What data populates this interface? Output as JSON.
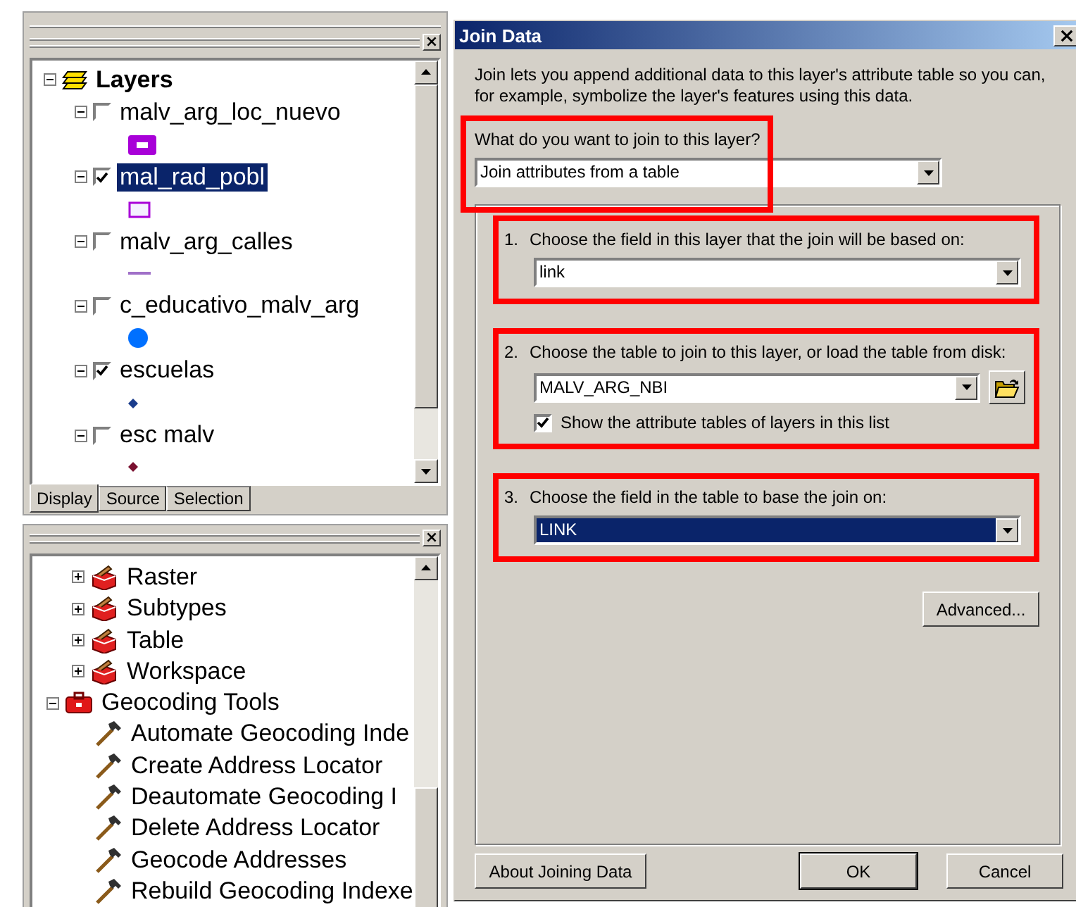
{
  "layers_panel": {
    "root": {
      "label": "Layers",
      "expanded": true,
      "children": [
        {
          "label": "malv_arg_loc_nuevo",
          "expanded": true,
          "checked": false,
          "selected": false,
          "symbol": {
            "kind": "filled-rect",
            "color": "#a800d8"
          }
        },
        {
          "label": "mal_rad_pobl",
          "expanded": true,
          "checked": true,
          "selected": true,
          "symbol": {
            "kind": "outline-rect",
            "color": "#a800d8"
          }
        },
        {
          "label": "malv_arg_calles",
          "expanded": true,
          "checked": false,
          "selected": false,
          "symbol": {
            "kind": "line",
            "color": "#a070c8"
          }
        },
        {
          "label": "c_educativo_malv_arg",
          "expanded": true,
          "checked": false,
          "selected": false,
          "symbol": {
            "kind": "circle",
            "color": "#0070ff"
          }
        },
        {
          "label": "escuelas",
          "expanded": true,
          "checked": true,
          "selected": false,
          "symbol": {
            "kind": "diamond",
            "color": "#1a3c8c"
          }
        },
        {
          "label": "esc malv",
          "expanded": true,
          "checked": false,
          "selected": false,
          "symbol": {
            "kind": "diamond",
            "color": "#7a1030"
          }
        }
      ]
    },
    "tabs": [
      {
        "label": "Display",
        "selected": true
      },
      {
        "label": "Source",
        "selected": false
      },
      {
        "label": "Selection",
        "selected": false
      }
    ]
  },
  "toolbox_panel": {
    "tree": [
      {
        "children": [
          {
            "label": "Raster",
            "kind": "toolset",
            "expanded": false
          },
          {
            "label": "Subtypes",
            "kind": "toolset",
            "expanded": false
          },
          {
            "label": "Table",
            "kind": "toolset",
            "expanded": false
          },
          {
            "label": "Workspace",
            "kind": "toolset",
            "expanded": false
          }
        ]
      },
      {
        "label": "Geocoding Tools",
        "kind": "toolbox",
        "expanded": true,
        "children": [
          {
            "label": "Automate Geocoding Inde",
            "kind": "tool"
          },
          {
            "label": "Create Address Locator",
            "kind": "tool"
          },
          {
            "label": "Deautomate Geocoding I",
            "kind": "tool"
          },
          {
            "label": "Delete Address Locator",
            "kind": "tool"
          },
          {
            "label": "Geocode Addresses",
            "kind": "tool"
          },
          {
            "label": "Rebuild Geocoding Indexe",
            "kind": "tool"
          }
        ]
      }
    ]
  },
  "dialog": {
    "title": "Join Data",
    "description": "Join lets you append additional data to this layer's attribute table so you can, for example, symbolize the layer's features using this data.",
    "question": "What do you want to join to this layer?",
    "join_type": {
      "value": "Join attributes from a table"
    },
    "steps": [
      {
        "number": "1.",
        "label": "Choose the field in this layer that the join will be based on:",
        "field": {
          "value": "link",
          "selected": false
        },
        "browse": false
      },
      {
        "number": "2.",
        "label": "Choose the table to join to this layer, or load the table from disk:",
        "field": {
          "value": "MALV_ARG_NBI",
          "selected": false
        },
        "browse": true,
        "option": {
          "label": "Show the attribute tables of layers in this list",
          "checked": true
        }
      },
      {
        "number": "3.",
        "label": "Choose the field in the table to base the join on:",
        "field": {
          "value": "LINK",
          "selected": true
        },
        "browse": false
      }
    ],
    "advanced": "Advanced...",
    "buttons": [
      {
        "label": "About Joining Data",
        "kind": "help"
      },
      {
        "label": "OK",
        "kind": "default"
      },
      {
        "label": "Cancel",
        "kind": "normal"
      }
    ]
  }
}
